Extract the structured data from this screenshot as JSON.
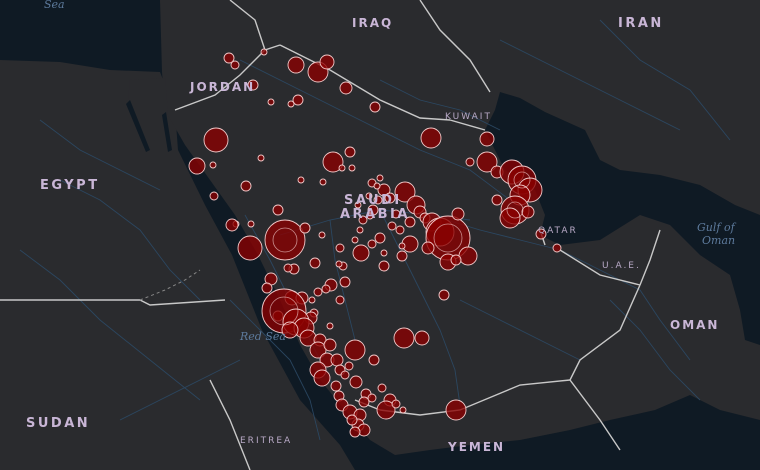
{
  "map": {
    "labels": {
      "sea": "Sea",
      "iraq": "IRAQ",
      "iran": "IRAN",
      "jordan": "JORDAN",
      "kuwait": "KUWAIT",
      "egypt": "EGYPT",
      "saudi_line1": "SAUDI",
      "saudi_line2": "ARABIA",
      "qatar": "QATAR",
      "uae": "U.A.E.",
      "gulf_line1": "Gulf of",
      "gulf_line2": "Oman",
      "oman": "OMAN",
      "red_sea": "Red Sea",
      "sudan": "SUDAN",
      "eritrea": "ERITREA",
      "yemen": "YEMEN"
    },
    "colors": {
      "land": "#2a2b2e",
      "water": "#0f1a24",
      "border": "#c8c8c8",
      "road": "#2c4a66",
      "bubble_fill": "#8b0000",
      "bubble_stroke": "#f0c8c8"
    }
  }
}
